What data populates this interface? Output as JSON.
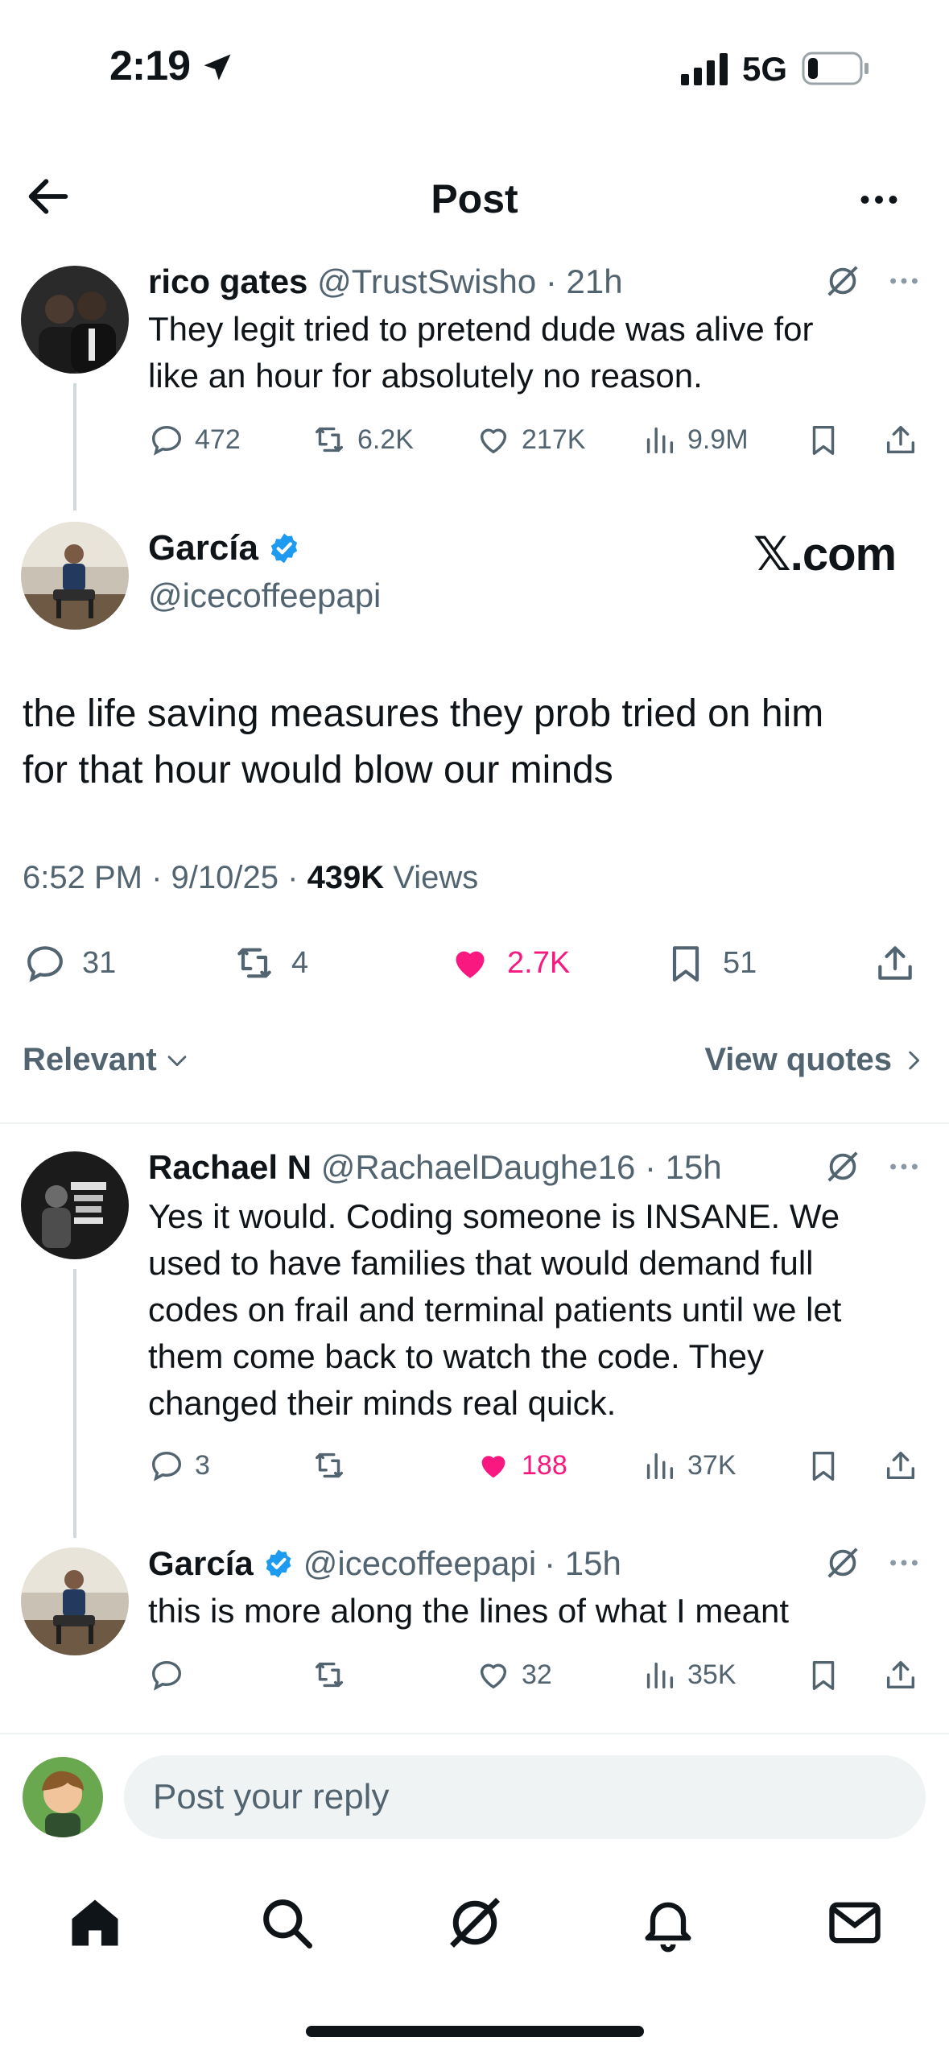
{
  "status_bar": {
    "time": "2:19",
    "network": "5G"
  },
  "header": {
    "title": "Post"
  },
  "parent_tweet": {
    "name": "rico gates",
    "handle": "@TrustSwisho",
    "time": "· 21h",
    "text_lines": [
      "They legit tried to pretend dude was alive for",
      "like an hour for absolutely no reason."
    ],
    "replies": "472",
    "reposts": "6.2K",
    "likes": "217K",
    "views": "9.9M"
  },
  "main_tweet": {
    "name": "García",
    "handle": "@icecoffeepapi",
    "watermark": "𝕏.com",
    "text_lines": [
      "the life saving measures they prob tried on him",
      "for that hour would blow our minds"
    ],
    "time": "6:52 PM",
    "date": "9/10/25",
    "views_count": "439K",
    "views_label": "Views",
    "replies": "31",
    "reposts": "4",
    "likes": "2.7K",
    "bookmarks": "51"
  },
  "sort": {
    "relevant_label": "Relevant",
    "view_quotes_label": "View quotes"
  },
  "replies": [
    {
      "name": "Rachael N",
      "handle": "@RachaelDaughe16",
      "time": "· 15h",
      "text_lines": [
        "Yes it would. Coding someone is INSANE. We",
        "used to have families that would demand full",
        "codes on frail and terminal patients until we let",
        "them come back to watch the code. They",
        "changed their minds real quick."
      ],
      "replies": "3",
      "reposts": "",
      "likes": "188",
      "views": "37K"
    },
    {
      "name": "García",
      "handle": "@icecoffeepapi",
      "time": "· 15h",
      "text_lines": [
        "this is more along the lines of what I meant"
      ],
      "replies": "",
      "reposts": "",
      "likes": "32",
      "views": "35K"
    }
  ],
  "reply_box": {
    "placeholder": "Post your reply"
  },
  "colors": {
    "like_pink": "#f91880",
    "verified_blue": "#1d9bf0",
    "muted": "#536471"
  },
  "icons": [
    "back-arrow-icon",
    "more-icon",
    "grok-icon",
    "reply-icon",
    "repost-icon",
    "heart-icon",
    "views-icon",
    "bookmark-icon",
    "share-icon",
    "home-icon",
    "search-icon",
    "notifications-icon",
    "messages-icon"
  ]
}
